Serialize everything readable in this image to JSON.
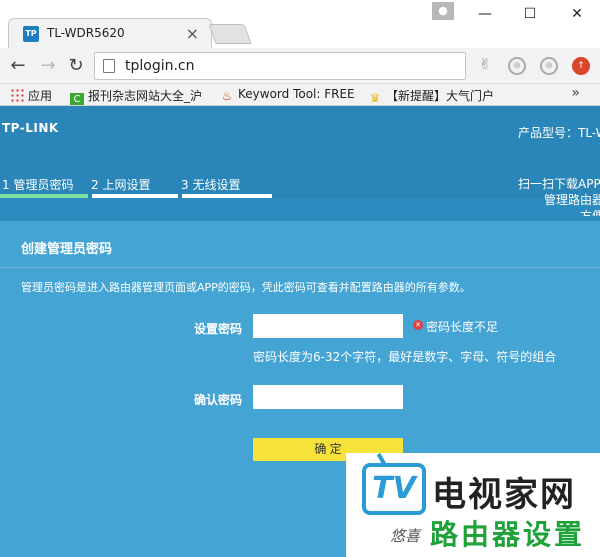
{
  "browser": {
    "tab_title": "TL-WDR5620",
    "tab_favicon": "TP",
    "url": "tplogin.cn",
    "bookmarks": [
      {
        "label": "应用",
        "icon": "apps-grid-icon"
      },
      {
        "label": "报刊杂志网站大全_沪",
        "icon": "green-c-icon"
      },
      {
        "label": "Keyword Tool: FREE",
        "icon": "flame-icon"
      },
      {
        "label": "【新提醒】大气门户",
        "icon": "trophy-icon"
      }
    ],
    "bookmarks_more": "»"
  },
  "router": {
    "logo": "TP-LINK",
    "model_label": "产品型号：TL-W",
    "steps": [
      {
        "label": "1 管理员密码",
        "active": true
      },
      {
        "label": "2 上网设置",
        "active": false
      },
      {
        "label": "3 无线设置",
        "active": false
      }
    ],
    "scan_line1": "扫一扫下载APP",
    "scan_line2": "管理路由器",
    "scan_line3": "方便",
    "panel": {
      "title": "创建管理员密码",
      "description": "管理员密码是进入路由器管理页面或APP的密码，凭此密码可查看并配置路由器的所有参数。",
      "password_label": "设置密码",
      "password_value": "",
      "error_text": "密码长度不足",
      "hint": "密码长度为6-32个字符，最好是数字、字母、符号的组合",
      "confirm_label": "确认密码",
      "confirm_value": "",
      "submit": "确 定"
    }
  },
  "watermark": {
    "logo_text": "TV",
    "big_text": "电视家网",
    "signature": "悠喜",
    "green_text": "路由器设置"
  },
  "colors": {
    "header_bg": "#2a86b8",
    "panel_bg": "#44a5d5",
    "active_step": "#7ee0a0",
    "submit_bg": "#f5e33a"
  }
}
